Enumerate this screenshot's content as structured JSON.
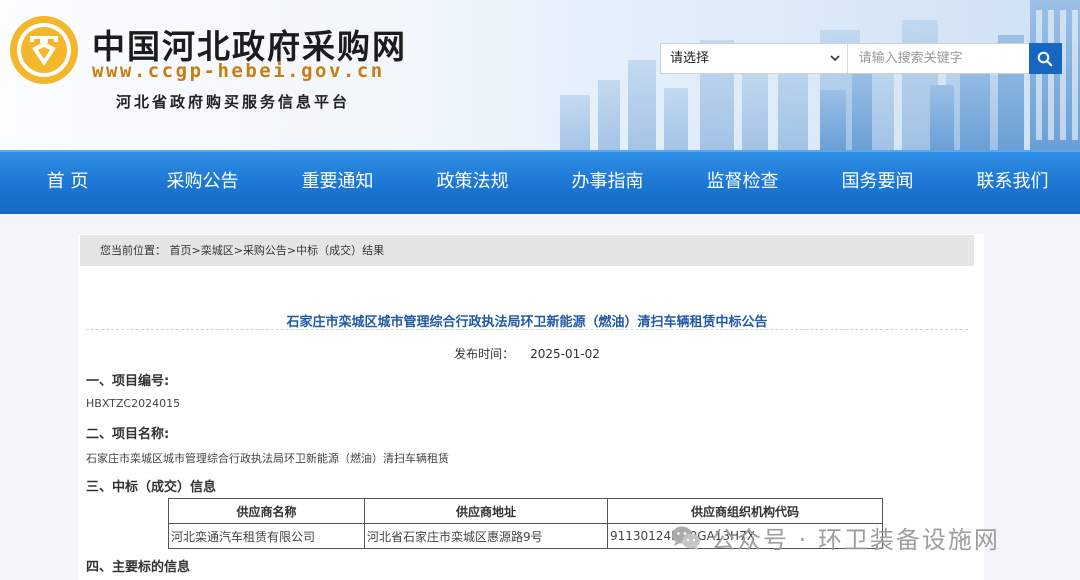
{
  "header": {
    "site_name": "中国河北政府采购网",
    "site_url": "www.ccgp-hebei.gov.cn",
    "slogan": "河北省政府购买服务信息平台"
  },
  "search": {
    "select_value": "请选择",
    "placeholder": "请输入搜索关键字"
  },
  "nav": {
    "items": [
      "首 页",
      "采购公告",
      "重要通知",
      "政策法规",
      "办事指南",
      "监督检查",
      "国务要闻",
      "联系我们"
    ]
  },
  "breadcrumb": {
    "prefix": "您当前位置：",
    "home": "首页",
    "district": "栾城区",
    "category": "采购公告",
    "current": "中标（成交）结果",
    "sep": ">"
  },
  "article": {
    "title": "石家庄市栾城区城市管理综合行政执法局环卫新能源（燃油）清扫车辆租赁中标公告",
    "date_label": "发布时间：",
    "date_value": "2025-01-02",
    "sec1_heading": "一、项目编号:",
    "project_no": "HBXTZC2024015",
    "sec2_heading": "二、项目名称:",
    "project_name": "石家庄市栾城区城市管理综合行政执法局环卫新能源（燃油）清扫车辆租赁",
    "sec3_heading": "三、中标（成交）信息",
    "sec4_heading": "四、主要标的信息"
  },
  "winner_table": {
    "headers": [
      "供应商名称",
      "供应商地址",
      "供应商组织机构代码"
    ],
    "rows": [
      [
        "河北栾通汽车租赁有限公司",
        "河北省石家庄市栾城区惠源路9号",
        "91130124MA0GA13H7X"
      ]
    ]
  },
  "watermark": {
    "text": "公众号 · 环卫装备设施网"
  },
  "colors": {
    "nav_blue": "#1b76d3",
    "title_blue": "#1f5aa6",
    "url_gold": "#c77d12",
    "search_button": "#1766c2"
  },
  "icons": [
    "emblem-logo",
    "chevron-down-icon",
    "search-icon",
    "wechat-icon"
  ]
}
